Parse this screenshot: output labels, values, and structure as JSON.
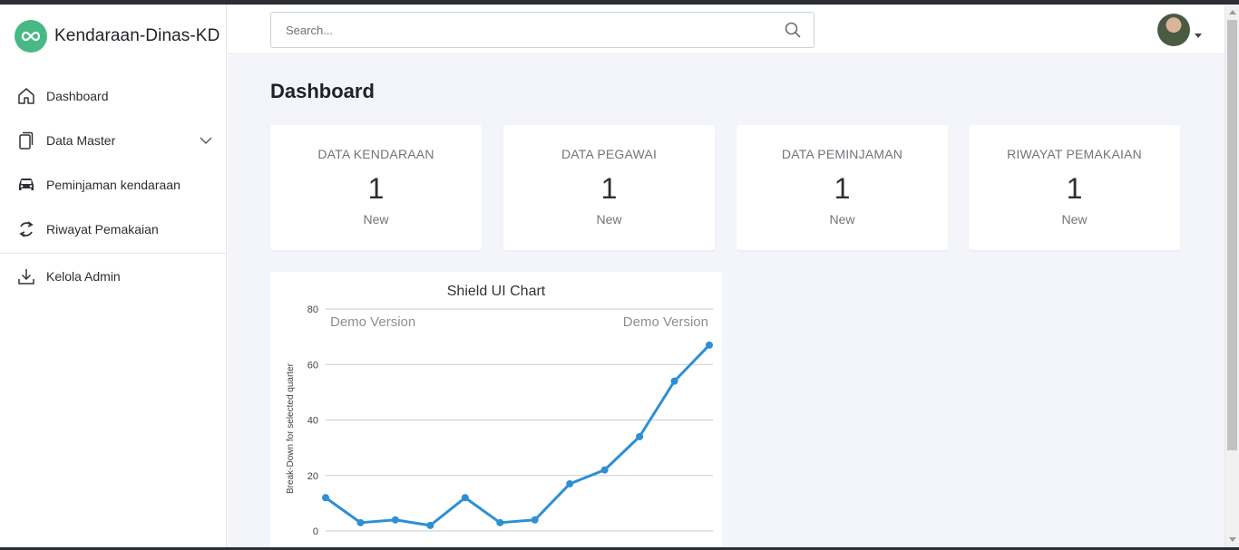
{
  "brand": {
    "name": "Kendaraan-Dinas-KD",
    "logo_icon": "infinity-icon",
    "logo_color": "#48b884"
  },
  "sidebar": {
    "items": [
      {
        "label": "Dashboard",
        "icon": "home-icon"
      },
      {
        "label": "Data Master",
        "icon": "copy-icon",
        "expandable": true
      },
      {
        "label": "Peminjaman kendaraan",
        "icon": "car-icon"
      },
      {
        "label": "Riwayat Pemakaian",
        "icon": "refresh-icon"
      },
      {
        "label": "Kelola Admin",
        "icon": "download-icon"
      }
    ]
  },
  "header": {
    "search_placeholder": "Search...",
    "search_value": ""
  },
  "main": {
    "title": "Dashboard",
    "cards": [
      {
        "title": "DATA KENDARAAN",
        "value": "1",
        "sub": "New"
      },
      {
        "title": "DATA PEGAWAI",
        "value": "1",
        "sub": "New"
      },
      {
        "title": "DATA PEMINJAMAN",
        "value": "1",
        "sub": "New"
      },
      {
        "title": "RIWAYAT PEMAKAIAN",
        "value": "1",
        "sub": "New"
      }
    ]
  },
  "chart_data": {
    "type": "line",
    "title": "Shield UI Chart",
    "ylabel": "Break-Down for selected quarter",
    "xlabel": "",
    "watermarks": [
      "Demo Version",
      "Demo Version"
    ],
    "ylim": [
      0,
      80
    ],
    "yticks": [
      0,
      20,
      40,
      60,
      80
    ],
    "series": [
      {
        "values": [
          12,
          3,
          4,
          2,
          12,
          3,
          4,
          17,
          22,
          34,
          54,
          67
        ]
      }
    ],
    "line_color": "#2d8fd4",
    "grid": true
  },
  "colors": {
    "accent": "#48b884",
    "background": "#f4f5fb"
  }
}
